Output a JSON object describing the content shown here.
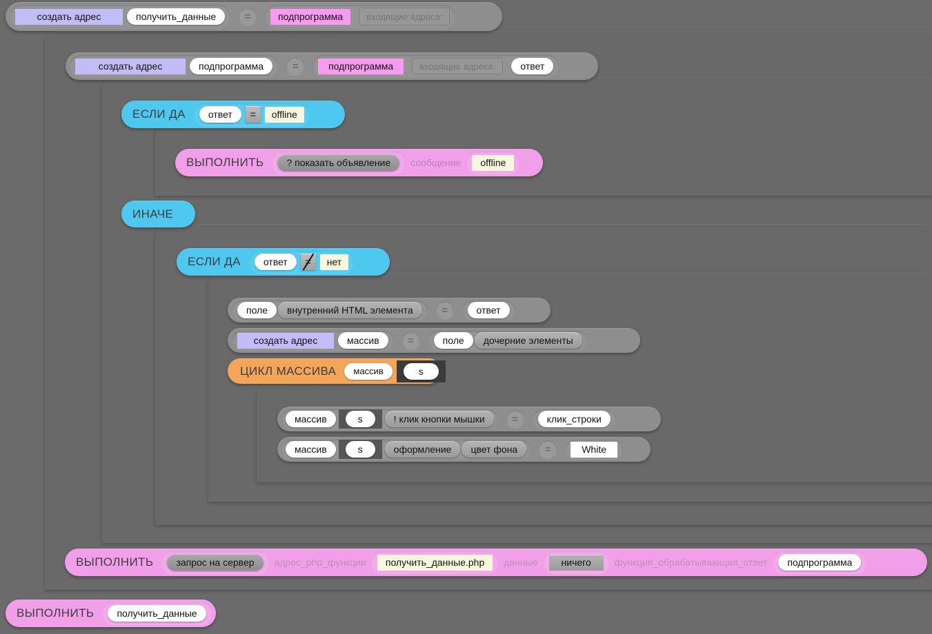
{
  "app": {
    "kind": "visual-block-code-editor",
    "background_color": "#6b6b6b"
  },
  "palette": {
    "band": "#696969",
    "row_gray": "#8e8e8e",
    "row_cyan": "#4ec8ef",
    "row_pink": "#f09fe8",
    "row_orange": "#f3a559",
    "pill_white": "#ffffff",
    "pill_lavender": "#c3bdf7",
    "pill_magenta": "#f79af0",
    "pill_cream": "#f5f5dc",
    "pill_gray": "#a0a0a0",
    "selection": "#3b3b3b"
  },
  "keywords": {
    "create_address": "создать адрес",
    "if_yes": "ЕСЛИ ДА",
    "else": "ИНАЧЕ",
    "execute": "ВЫПОЛНИТЬ",
    "array_loop": "ЦИКЛ МАССИВА"
  },
  "blocks": {
    "def_get_data": {
      "name": "создать адрес",
      "value": "получить_данные",
      "operator": "=",
      "type": "подпрограмма",
      "params_label": "входящие адреса:"
    },
    "def_subprogram": {
      "name": "создать адрес",
      "value": "подпрограмма",
      "operator": "=",
      "type": "подпрограмма",
      "params_label": "входящие адреса:",
      "param_1": "ответ"
    },
    "if_offline": {
      "keyword": "ЕСЛИ ДА",
      "left": "ответ",
      "operator": "=",
      "right": "offline"
    },
    "show_ad": {
      "keyword": "ВЫПОЛНИТЬ",
      "action": "? показать объявление",
      "arg_label": "сообщение",
      "arg_value": "offline"
    },
    "else_block": {
      "keyword": "ИНАЧЕ"
    },
    "if_not_no": {
      "keyword": "ЕСЛИ ДА",
      "left": "ответ",
      "operator": "≠",
      "right": "нет"
    },
    "assign_inner_html": {
      "target_obj": "поле",
      "target_prop": "внутренний HTML элемента",
      "operator": "=",
      "source": "ответ"
    },
    "assign_array": {
      "keyword": "создать адрес",
      "name": "массив",
      "operator": "=",
      "source_obj": "поле",
      "source_prop": "дочерние элементы"
    },
    "array_loop": {
      "keyword": "ЦИКЛ МАССИВА",
      "array": "массив",
      "index": "s"
    },
    "assign_click": {
      "obj": "массив",
      "index": "s",
      "prop": "! клик кнопки мышки",
      "operator": "=",
      "value": "клик_строки"
    },
    "assign_bgcolor": {
      "obj": "массив",
      "index": "s",
      "prop1": "оформление",
      "prop2": "цвет фона",
      "operator": "=",
      "value": "White"
    },
    "server_request": {
      "keyword": "ВЫПОЛНИТЬ",
      "action": "запрос на сервер",
      "arg1_label": "адрес_php_функции",
      "arg1_value": "получить_данные.php",
      "arg2_label": "данные",
      "arg2_value": "ничего",
      "arg3_label": "функция_обрабатывающая_ответ",
      "arg3_value": "подпрограмма"
    },
    "call_get_data": {
      "keyword": "ВЫПОЛНИТЬ",
      "action": "получить_данные"
    }
  }
}
